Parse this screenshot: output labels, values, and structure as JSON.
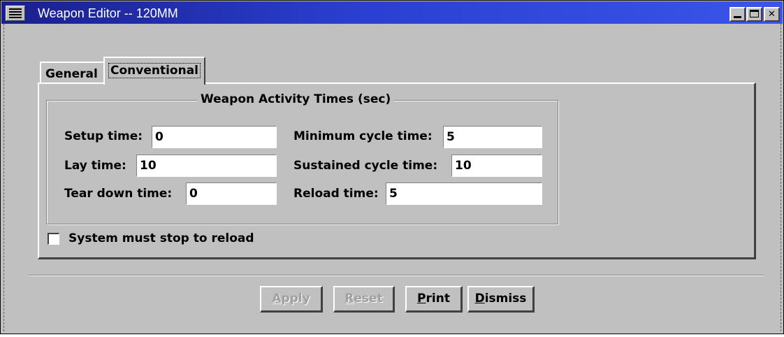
{
  "window": {
    "title": "Weapon Editor -- 120MM",
    "icons": {
      "system_menu": "system-menu-icon",
      "minimize": "minimize-icon",
      "maximize": "maximize-icon",
      "close": "close-icon"
    }
  },
  "tabs": [
    {
      "label": "General",
      "selected": false
    },
    {
      "label": "Conventional",
      "selected": true
    }
  ],
  "group": {
    "title": "Weapon Activity Times (sec)"
  },
  "fields": {
    "setup_time": {
      "label": "Setup time:",
      "value": "0"
    },
    "lay_time": {
      "label": "Lay time:",
      "value": "10"
    },
    "tear_down_time": {
      "label": "Tear down time:",
      "value": "0"
    },
    "minimum_cycle_time": {
      "label": "Minimum cycle time:",
      "value": "5"
    },
    "sustained_cycle_time": {
      "label": "Sustained cycle time:",
      "value": "10"
    },
    "reload_time": {
      "label": "Reload time:",
      "value": "5"
    }
  },
  "checkbox": {
    "label": "System must stop to reload",
    "checked": false
  },
  "buttons": {
    "apply": {
      "mnemonic": "A",
      "rest": "pply",
      "enabled": false
    },
    "reset": {
      "mnemonic": "R",
      "rest": "eset",
      "enabled": false
    },
    "print": {
      "mnemonic": "P",
      "rest": "rint",
      "enabled": true
    },
    "dismiss": {
      "mnemonic": "D",
      "rest": "ismiss",
      "enabled": true
    }
  },
  "colors": {
    "title_bar_start": "#1a1f8c",
    "title_bar_end": "#3a55ea",
    "face": "#c0c0c0"
  }
}
